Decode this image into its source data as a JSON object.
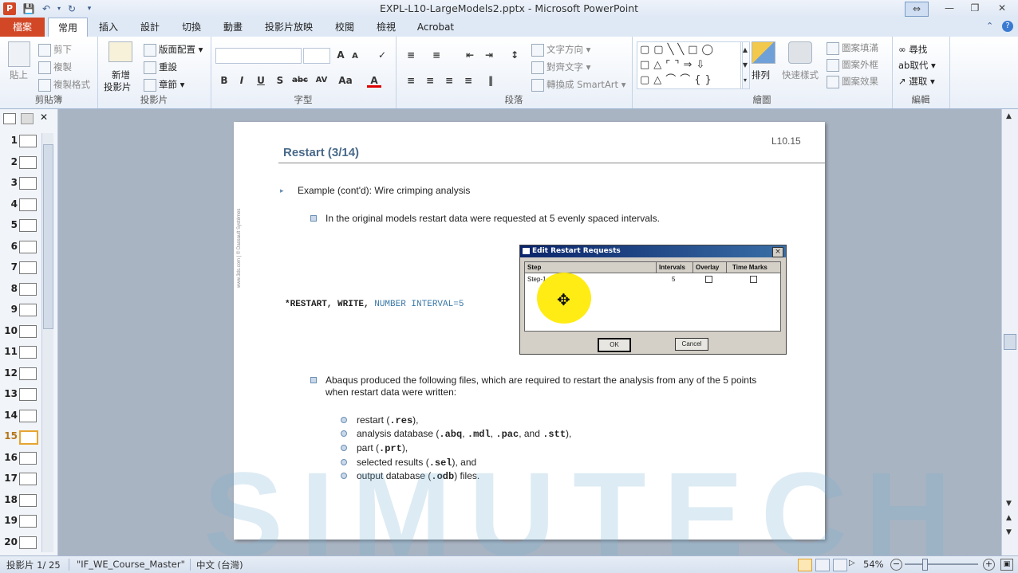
{
  "window": {
    "title": "EXPL-L10-LargeModels2.pptx - Microsoft PowerPoint",
    "app_icon": "P"
  },
  "tabs": [
    "檔案",
    "常用",
    "插入",
    "設計",
    "切換",
    "動畫",
    "投影片放映",
    "校閱",
    "檢視",
    "Acrobat"
  ],
  "ribbon": {
    "clipboard": {
      "name": "剪貼簿",
      "paste": "貼上",
      "cut": "剪下",
      "copy": "複製",
      "format_painter": "複製格式"
    },
    "slides": {
      "name": "投影片",
      "new_slide_1": "新增",
      "new_slide_2": "投影片",
      "layout": "版面配置",
      "reset": "重設",
      "section": "章節"
    },
    "font": {
      "name": "字型",
      "bold": "B",
      "italic": "I",
      "underline": "U",
      "shadow": "S",
      "strike": "abc",
      "spacing": "AV",
      "case": "Aa",
      "color": "A",
      "grow": "A",
      "shrink": "A"
    },
    "paragraph": {
      "name": "段落",
      "text_direction": "文字方向",
      "align_text": "對齊文字",
      "smartart": "轉換成 SmartArt"
    },
    "drawing": {
      "name": "繪圖",
      "arrange": "排列",
      "quick_styles": "快速樣式",
      "shape_fill": "圖案填滿",
      "shape_outline": "圖案外框",
      "shape_effects": "圖案效果"
    },
    "editing": {
      "name": "編輯",
      "find": "尋找",
      "replace": "取代",
      "select": "選取"
    }
  },
  "thumbnails": [
    "1",
    "2",
    "3",
    "4",
    "5",
    "6",
    "7",
    "8",
    "9",
    "10",
    "11",
    "12",
    "13",
    "14",
    "15",
    "16",
    "17",
    "18",
    "19",
    "20"
  ],
  "selected_slide": 15,
  "slide": {
    "page_no": "L10.15",
    "title": "Restart (3/14)",
    "bullet1": "Example (cont'd): Wire crimping analysis",
    "sub1": "In the original models restart data were requested at 5 evenly spaced intervals.",
    "code_a": "*RESTART, WRITE, ",
    "code_b": "NUMBER INTERVAL=5",
    "side_text": "www.3ds.com | © Dassault Systèmes",
    "sub2_a": "Abaqus produced the following files, which are required to restart the analysis from any of the 5 points",
    "sub2_b": "when restart data were written:",
    "files": [
      {
        "pre": "restart (",
        "ext": ".res",
        "post": "),"
      },
      {
        "pre": "analysis database (",
        "ext": ".abq",
        "mid1": ", ",
        "ext2": ".mdl",
        "mid2": ", ",
        "ext3": ".pac",
        "mid3": ", and ",
        "ext4": ".stt",
        "post": "),"
      },
      {
        "pre": "part (",
        "ext": ".prt",
        "post": "),"
      },
      {
        "pre": "selected results (",
        "ext": ".sel",
        "post": "), and"
      },
      {
        "pre": "output database (",
        "ext": ".odb",
        "post": ") files."
      }
    ]
  },
  "dialog": {
    "title": "Edit Restart Requests",
    "col_step": "Step",
    "col_intervals": "Intervals",
    "col_overlay": "Overlay",
    "col_timemarks": "Time Marks",
    "row_step": "Step-1",
    "row_intervals": "5",
    "ok": "OK",
    "cancel": "Cancel",
    "close": "×"
  },
  "status": {
    "slide_info": "投影片 1/ 25",
    "theme": "\"IF_WE_Course_Master\"",
    "language": "中文 (台灣)",
    "zoom": "54%"
  },
  "watermark": "SIMUTECH",
  "colors": {
    "file_tab": "#d24726",
    "title_text": "#4a6a8a",
    "code_blue": "#3a78a8",
    "highlight": "#ffea00"
  }
}
